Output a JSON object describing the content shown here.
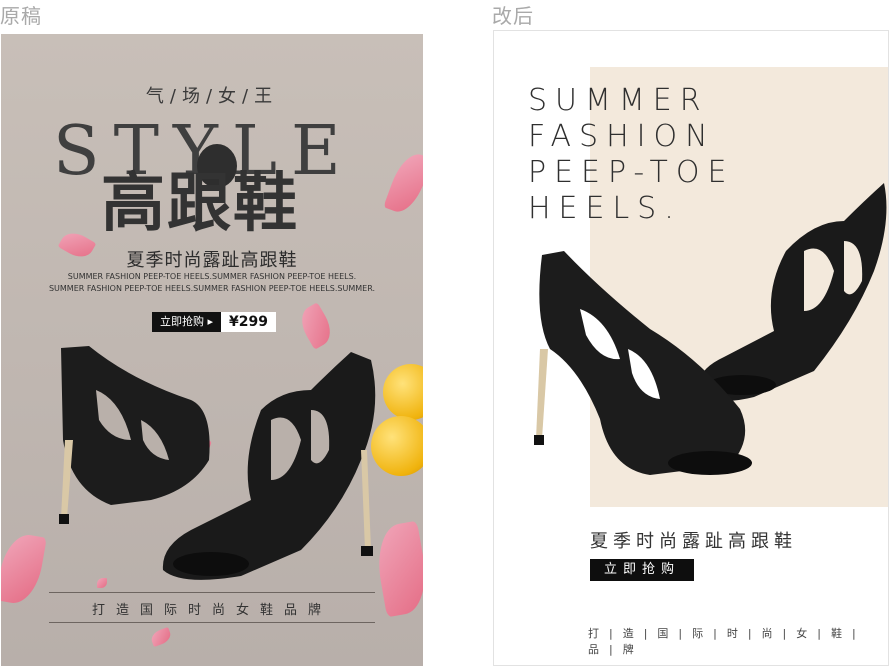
{
  "captions": {
    "original": "原稿",
    "revised": "改后"
  },
  "poster_left": {
    "tagline": "气/场/女/王",
    "style_word": "STYLE",
    "title": "高跟鞋",
    "subtitle": "夏季时尚露趾高跟鞋",
    "en_line1": "SUMMER FASHION PEEP-TOE HEELS.SUMMER FASHION PEEP-TOE HEELS.",
    "en_line2": "SUMMER FASHION PEEP-TOE HEELS.SUMMER FASHION PEEP-TOE HEELS.SUMMER.",
    "buy_label": "立即抢购 ▸",
    "price": "¥299",
    "footer": "打造国际时尚女鞋品牌",
    "accent": "#e9637f"
  },
  "poster_right": {
    "en_lines": [
      "SUMMER",
      "FASHION",
      "PEEP-TOE",
      "HEELS."
    ],
    "subtitle": "夏季时尚露趾高跟鞋",
    "buy_label": "立即抢购",
    "footer": "打|造|国|际|时|尚|女|鞋|品|牌",
    "panel_color": "#f3e9dc"
  }
}
